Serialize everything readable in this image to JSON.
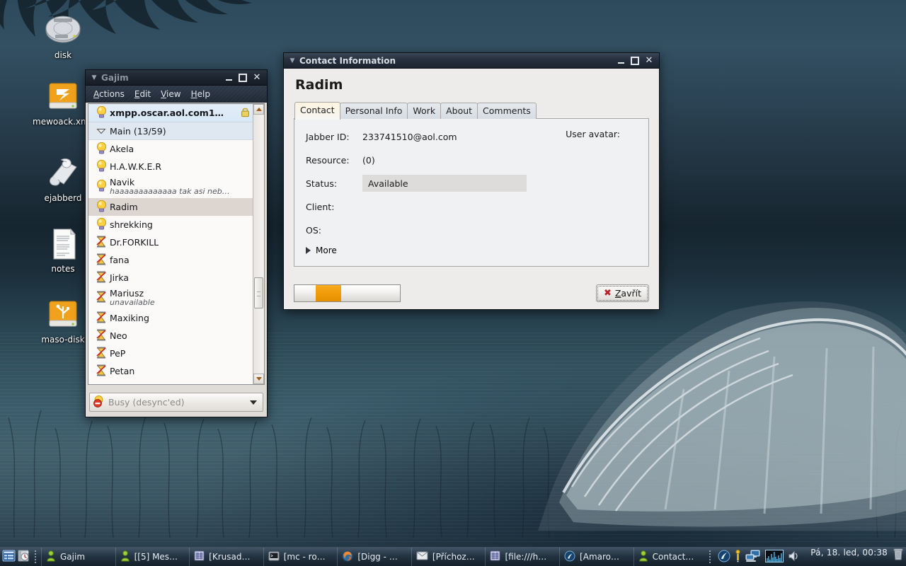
{
  "desktop": {
    "icons": [
      {
        "name": "disk",
        "label": "disk",
        "glyph": "harddisk-icon"
      },
      {
        "name": "mewoack",
        "label": "mewoack.xmp",
        "glyph": "orange-drive-icon"
      },
      {
        "name": "ejabberd",
        "label": "ejabberd",
        "glyph": "scroll-icon"
      },
      {
        "name": "notes",
        "label": "notes",
        "glyph": "text-document-icon"
      },
      {
        "name": "maso-disk",
        "label": "maso-disk",
        "glyph": "usb-drive-icon"
      }
    ]
  },
  "gajim": {
    "title": "Gajim",
    "menu": [
      {
        "label": "Actions",
        "accel": "A"
      },
      {
        "label": "Edit",
        "accel": "E"
      },
      {
        "label": "View",
        "accel": "V"
      },
      {
        "label": "Help",
        "accel": "H"
      }
    ],
    "window_buttons": {
      "minimize": "minimize",
      "maximize": "maximize",
      "close": "close"
    },
    "account": {
      "label": "xmpp.oscar.aol.com1…",
      "status_icon": "online-bulb-icon",
      "secure_icon": "lock-icon"
    },
    "group": {
      "label": "Main (13/59)",
      "expander": "expander-open-icon"
    },
    "contacts": [
      {
        "name": "Akela",
        "presence": "online-bulb-icon",
        "status_msg": "",
        "selected": false
      },
      {
        "name": "H.A.W.K.E.R",
        "presence": "online-bulb-icon",
        "status_msg": "",
        "selected": false
      },
      {
        "name": "Navik",
        "presence": "online-bulb-icon",
        "status_msg": "haaaaaaaaaaaaa tak asi neb…",
        "selected": false
      },
      {
        "name": "Radim",
        "presence": "online-bulb-icon",
        "status_msg": "",
        "selected": true
      },
      {
        "name": "shrekking",
        "presence": "online-bulb-icon",
        "status_msg": "",
        "selected": false
      },
      {
        "name": "Dr.FORKILL",
        "presence": "offline-icon",
        "status_msg": "",
        "selected": false
      },
      {
        "name": "fana",
        "presence": "offline-icon",
        "status_msg": "",
        "selected": false
      },
      {
        "name": "Jirka",
        "presence": "offline-icon",
        "status_msg": "",
        "selected": false
      },
      {
        "name": "Mariusz",
        "presence": "offline-icon",
        "status_msg": "unavailable",
        "selected": false
      },
      {
        "name": "Maxiking",
        "presence": "offline-icon",
        "status_msg": "",
        "selected": false
      },
      {
        "name": "Neo",
        "presence": "offline-icon",
        "status_msg": "",
        "selected": false
      },
      {
        "name": "PeP",
        "presence": "offline-icon",
        "status_msg": "",
        "selected": false
      },
      {
        "name": "Petan",
        "presence": "offline-icon",
        "status_msg": "",
        "selected": false
      }
    ],
    "status_selector": {
      "value": "Busy (desync'ed)",
      "icon": "busy-icon"
    }
  },
  "vcard": {
    "title": "Contact Information",
    "contact_name": "Radim",
    "tabs": [
      {
        "label": "Contact",
        "active": true
      },
      {
        "label": "Personal Info",
        "active": false
      },
      {
        "label": "Work",
        "active": false
      },
      {
        "label": "About",
        "active": false
      },
      {
        "label": "Comments",
        "active": false
      }
    ],
    "fields": [
      {
        "label": "Jabber ID:",
        "value": "233741510@aol.com",
        "boxed": false
      },
      {
        "label": "Resource:",
        "value": "(0)",
        "boxed": false
      },
      {
        "label": "Status:",
        "value": "Available",
        "boxed": true
      },
      {
        "label": "Client:",
        "value": "",
        "boxed": false
      },
      {
        "label": "OS:",
        "value": "",
        "boxed": false
      }
    ],
    "avatar_label": "User avatar:",
    "more_label": "More",
    "progress": {
      "value_percent": 24,
      "chunk_left_percent": 20,
      "chunk_width_percent": 24
    },
    "close_button": {
      "label_pre": "",
      "accel": "Z",
      "label_post": "avřít",
      "full": "Zavřít",
      "icon": "close-x-icon"
    },
    "window_buttons": {
      "minimize": "minimize",
      "maximize": "maximize",
      "close": "close"
    }
  },
  "taskbar": {
    "launchers": [
      {
        "name": "window-list-launcher",
        "glyph": "window-list-icon"
      },
      {
        "name": "clock-app-launcher",
        "glyph": "clock-book-icon"
      }
    ],
    "tasks": [
      {
        "label": "Gajim",
        "icon": "gajim-icon",
        "active": false
      },
      {
        "label": "[[5] Mes…",
        "icon": "gajim-icon",
        "active": false
      },
      {
        "label": "[Krusad…",
        "icon": "krusader-icon",
        "active": false
      },
      {
        "label": "[mc - ro…",
        "icon": "terminal-icon",
        "active": false
      },
      {
        "label": "[Digg - …",
        "icon": "firefox-icon",
        "active": false
      },
      {
        "label": "[Příchoz…",
        "icon": "mail-icon",
        "active": false
      },
      {
        "label": "[file:///h…",
        "icon": "krusader-icon",
        "active": false
      },
      {
        "label": "[Amaro…",
        "icon": "amarok-icon",
        "active": false
      },
      {
        "label": "Contact…",
        "icon": "gajim-icon",
        "active": true
      }
    ],
    "tray": [
      {
        "name": "amarok-tray-icon",
        "glyph": "amarok-icon"
      },
      {
        "name": "klipper-tray-icon",
        "glyph": "pin-icon"
      },
      {
        "name": "network-monitor-tray-icon",
        "glyph": "two-monitors-icon"
      },
      {
        "name": "system-load-tray-icon",
        "glyph": "load-graph-icon"
      },
      {
        "name": "volume-tray-icon",
        "glyph": "speaker-icon"
      }
    ],
    "clock": "Pá, 18. led, 00:38",
    "trash": {
      "name": "trash-icon",
      "glyph": "trash-can-icon"
    }
  }
}
